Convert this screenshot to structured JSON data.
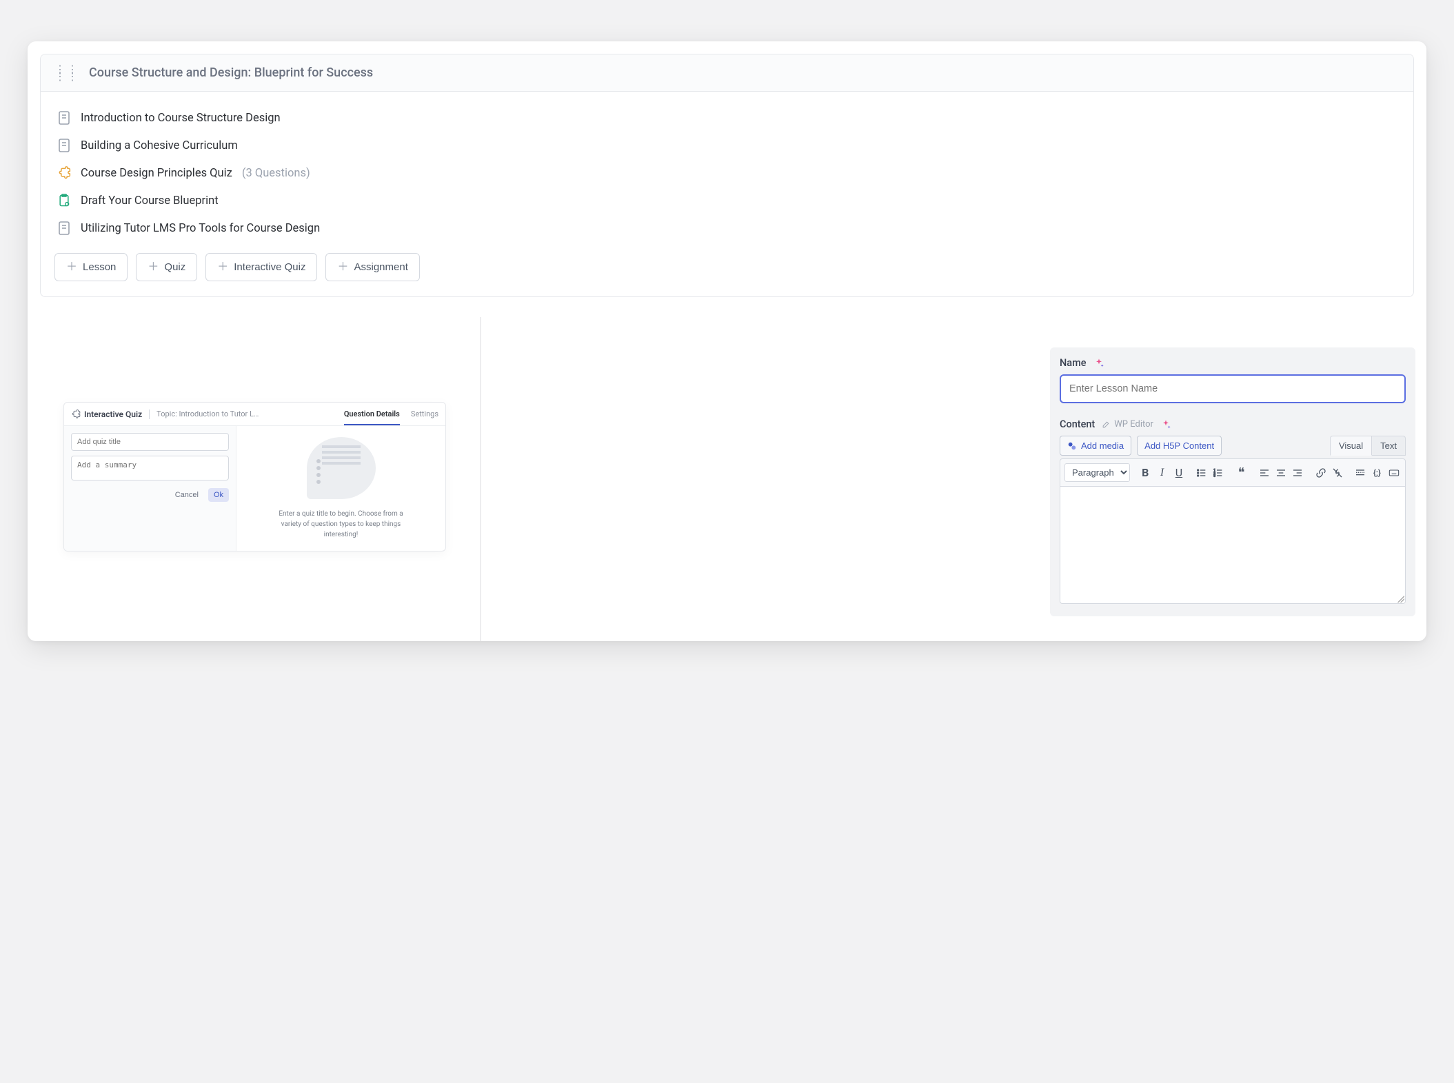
{
  "course": {
    "title": "Course Structure and Design: Blueprint for Success",
    "items": [
      {
        "type": "lesson",
        "label": "Introduction to Course Structure Design"
      },
      {
        "type": "lesson",
        "label": "Building a Cohesive Curriculum"
      },
      {
        "type": "quiz",
        "label": "Course Design Principles Quiz",
        "count_label": "(3 Questions)"
      },
      {
        "type": "assignment",
        "label": "Draft Your Course Blueprint"
      },
      {
        "type": "lesson",
        "label": "Utilizing Tutor LMS Pro Tools for Course Design"
      }
    ],
    "actions": {
      "lesson": "Lesson",
      "quiz": "Quiz",
      "interactive_quiz": "Interactive Quiz",
      "assignment": "Assignment"
    }
  },
  "lesson_editor": {
    "name_label": "Name",
    "name_placeholder": "Enter Lesson Name",
    "content_label": "Content",
    "wp_editor_label": "WP Editor",
    "add_media": "Add media",
    "add_h5p": "Add H5P Content",
    "tab_visual": "Visual",
    "tab_text": "Text",
    "format_label": "Paragraph"
  },
  "quiz_panel": {
    "panel_title": "Interactive Quiz",
    "topic": "Topic: Introduction to Tutor LMS P...",
    "tab_details": "Question Details",
    "tab_settings": "Settings",
    "title_placeholder": "Add quiz title",
    "summary_placeholder": "Add a summary",
    "cancel": "Cancel",
    "ok": "Ok",
    "hint": "Enter a quiz title to begin. Choose from a variety of question types to keep things interesting!"
  },
  "colors": {
    "accent": "#5b6ee1",
    "quiz_icon": "#e7a53b",
    "assignment_icon": "#1fa97a"
  }
}
